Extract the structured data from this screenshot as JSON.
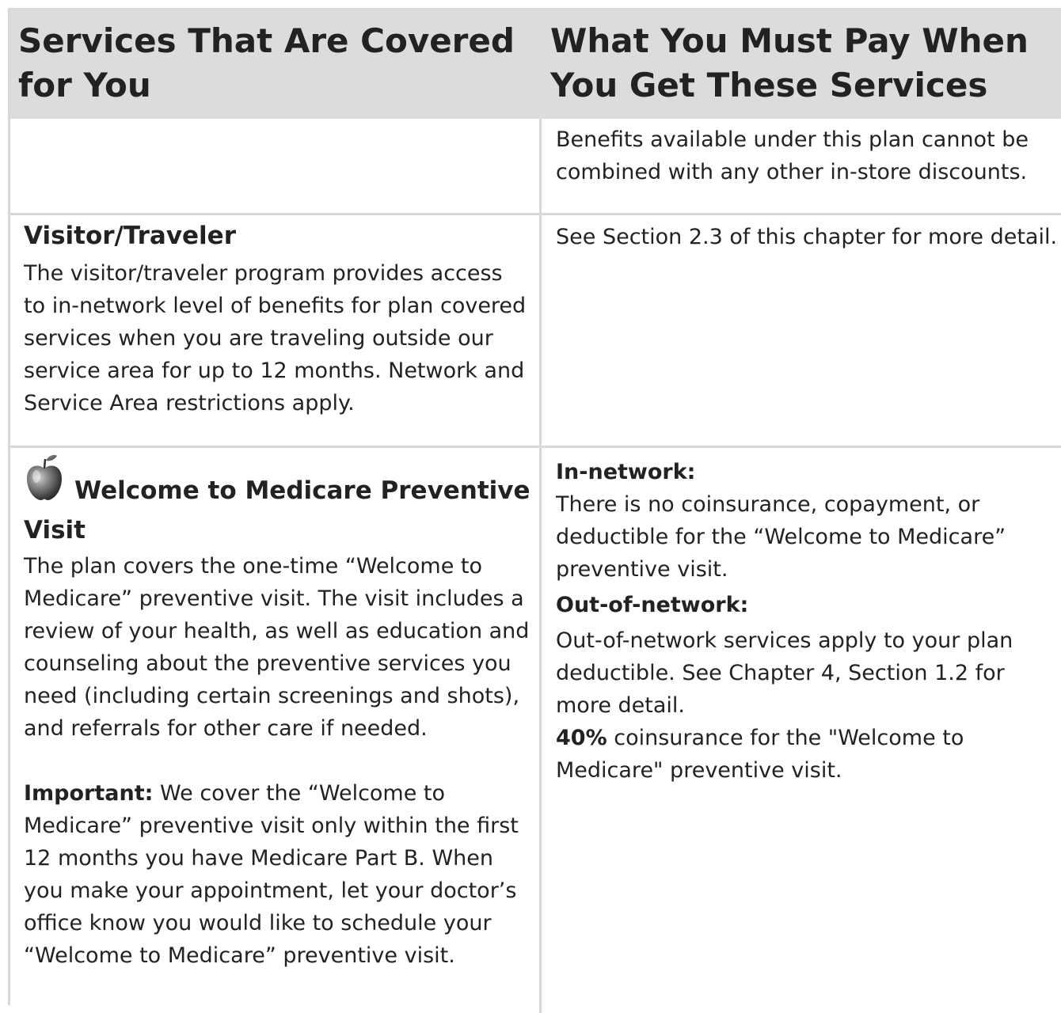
{
  "header": {
    "col1": "Services That Are Covered for You",
    "col2": "What You Must Pay When You Get These Services"
  },
  "rows": [
    {
      "right": "Benefits available under this plan cannot be combined with any other in-store discounts."
    },
    {
      "title": "Visitor/Traveler",
      "left_body": "The visitor/traveler program provides access to in-network level of benefits for plan covered services when you are traveling outside our service area for up to 12 months. Network and Service Area restrictions apply.",
      "right": "See Section 2.3 of this chapter for more detail."
    },
    {
      "icon": "apple-icon",
      "title": "Welcome to Medicare Preventive Visit",
      "left_body": "The plan covers the one-time “Welcome to Medicare” preventive visit. The visit includes a review of your health, as well as education and counseling about the preventive services you need (including certain screenings and shots), and referrals for other care if needed.",
      "important_label": "Important:",
      "important_text": " We cover the “Welcome to Medicare” preventive visit only within the first 12 months you have Medicare Part B. When you make your appointment, let your doctor’s office know you would like to schedule your “Welcome to Medicare” preventive visit.",
      "in_network_label": "In-network:",
      "in_network_text": "There is no coinsurance, copayment, or deductible for the “Welcome to Medicare” preventive visit.",
      "out_network_label": "Out-of-network:",
      "out_network_text": "Out-of-network services apply to your plan deductible. See Chapter 4, Section 1.2 for more detail.",
      "coinsurance_value": "40%",
      "coinsurance_text": " coinsurance for the \"Welcome to Medicare\" preventive visit."
    }
  ]
}
